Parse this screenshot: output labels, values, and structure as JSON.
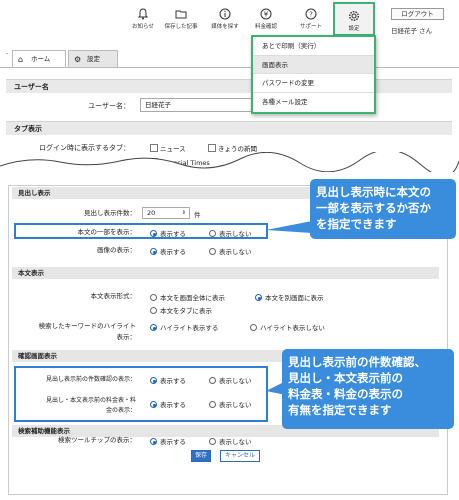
{
  "toolbar": {
    "items": [
      {
        "label": "お知らせ",
        "icon": "bell-icon"
      },
      {
        "label": "保存した記事",
        "icon": "folder-icon"
      },
      {
        "label": "媒体を探す",
        "icon": "info-icon"
      },
      {
        "label": "料金確認",
        "icon": "yen-icon"
      },
      {
        "label": "サポート",
        "icon": "help-icon"
      },
      {
        "label": "設定",
        "icon": "gear-icon"
      }
    ],
    "logout": "ログアウト",
    "user": "日経花子 さん"
  },
  "tabs": {
    "home": "ホーム",
    "settings": "設定"
  },
  "dropdown": {
    "items": [
      "あとで印刷（実行）",
      "画面表示",
      "パスワードの変更",
      "各種メール設定"
    ]
  },
  "top_form": {
    "username_section": "ユーザー名",
    "username_label": "ユーザー名：",
    "username_value": "日経花子",
    "tab_section": "タブ表示",
    "tab_label": "ログイン時に表示するタブ：",
    "tab_options": [
      "ニュース",
      "きょうの新聞",
      "Financial Times"
    ]
  },
  "headline": {
    "section": "見出し表示",
    "count_label": "見出し表示件数：",
    "count_value": "20",
    "count_unit": "件",
    "body_part_label": "本文の一部を表示：",
    "image_label": "画像の表示：",
    "opt_show": "表示する",
    "opt_hide": "表示しない"
  },
  "body_display": {
    "section": "本文表示",
    "format_label": "本文表示形式：",
    "format_options": [
      "本文を画面全体に表示",
      "本文を別画面に表示",
      "本文をタブに表示"
    ],
    "keyword_label_1": "検索したキーワードのハイライト",
    "keyword_label_2": "表示：",
    "keyword_options": [
      "ハイライト表示する",
      "ハイライト表示しない"
    ]
  },
  "confirm": {
    "section": "確認画面表示",
    "count_confirm_label": "見出し表示前の件数確認の表示：",
    "fee_label_1": "見出し・本文表示前の料金表・料",
    "fee_label_2": "金の表示："
  },
  "search_help": {
    "section": "検索補助機能表示",
    "tooltip_label": "検索ツールチップの表示："
  },
  "buttons": {
    "save": "保存",
    "cancel": "キャンセル"
  },
  "callouts": {
    "c1": [
      "見出し表示時に本文の",
      "一部を表示するか否か",
      "を指定できます"
    ],
    "c2": [
      "見出し表示前の件数確認、",
      "見出し・本文表示前の",
      "料金表・料金の表示の",
      "有無を指定できます"
    ]
  },
  "colors": {
    "highlight_green": "#3cb371",
    "callout_blue": "#3a8ddc",
    "radio_blue": "#1e63c4"
  }
}
